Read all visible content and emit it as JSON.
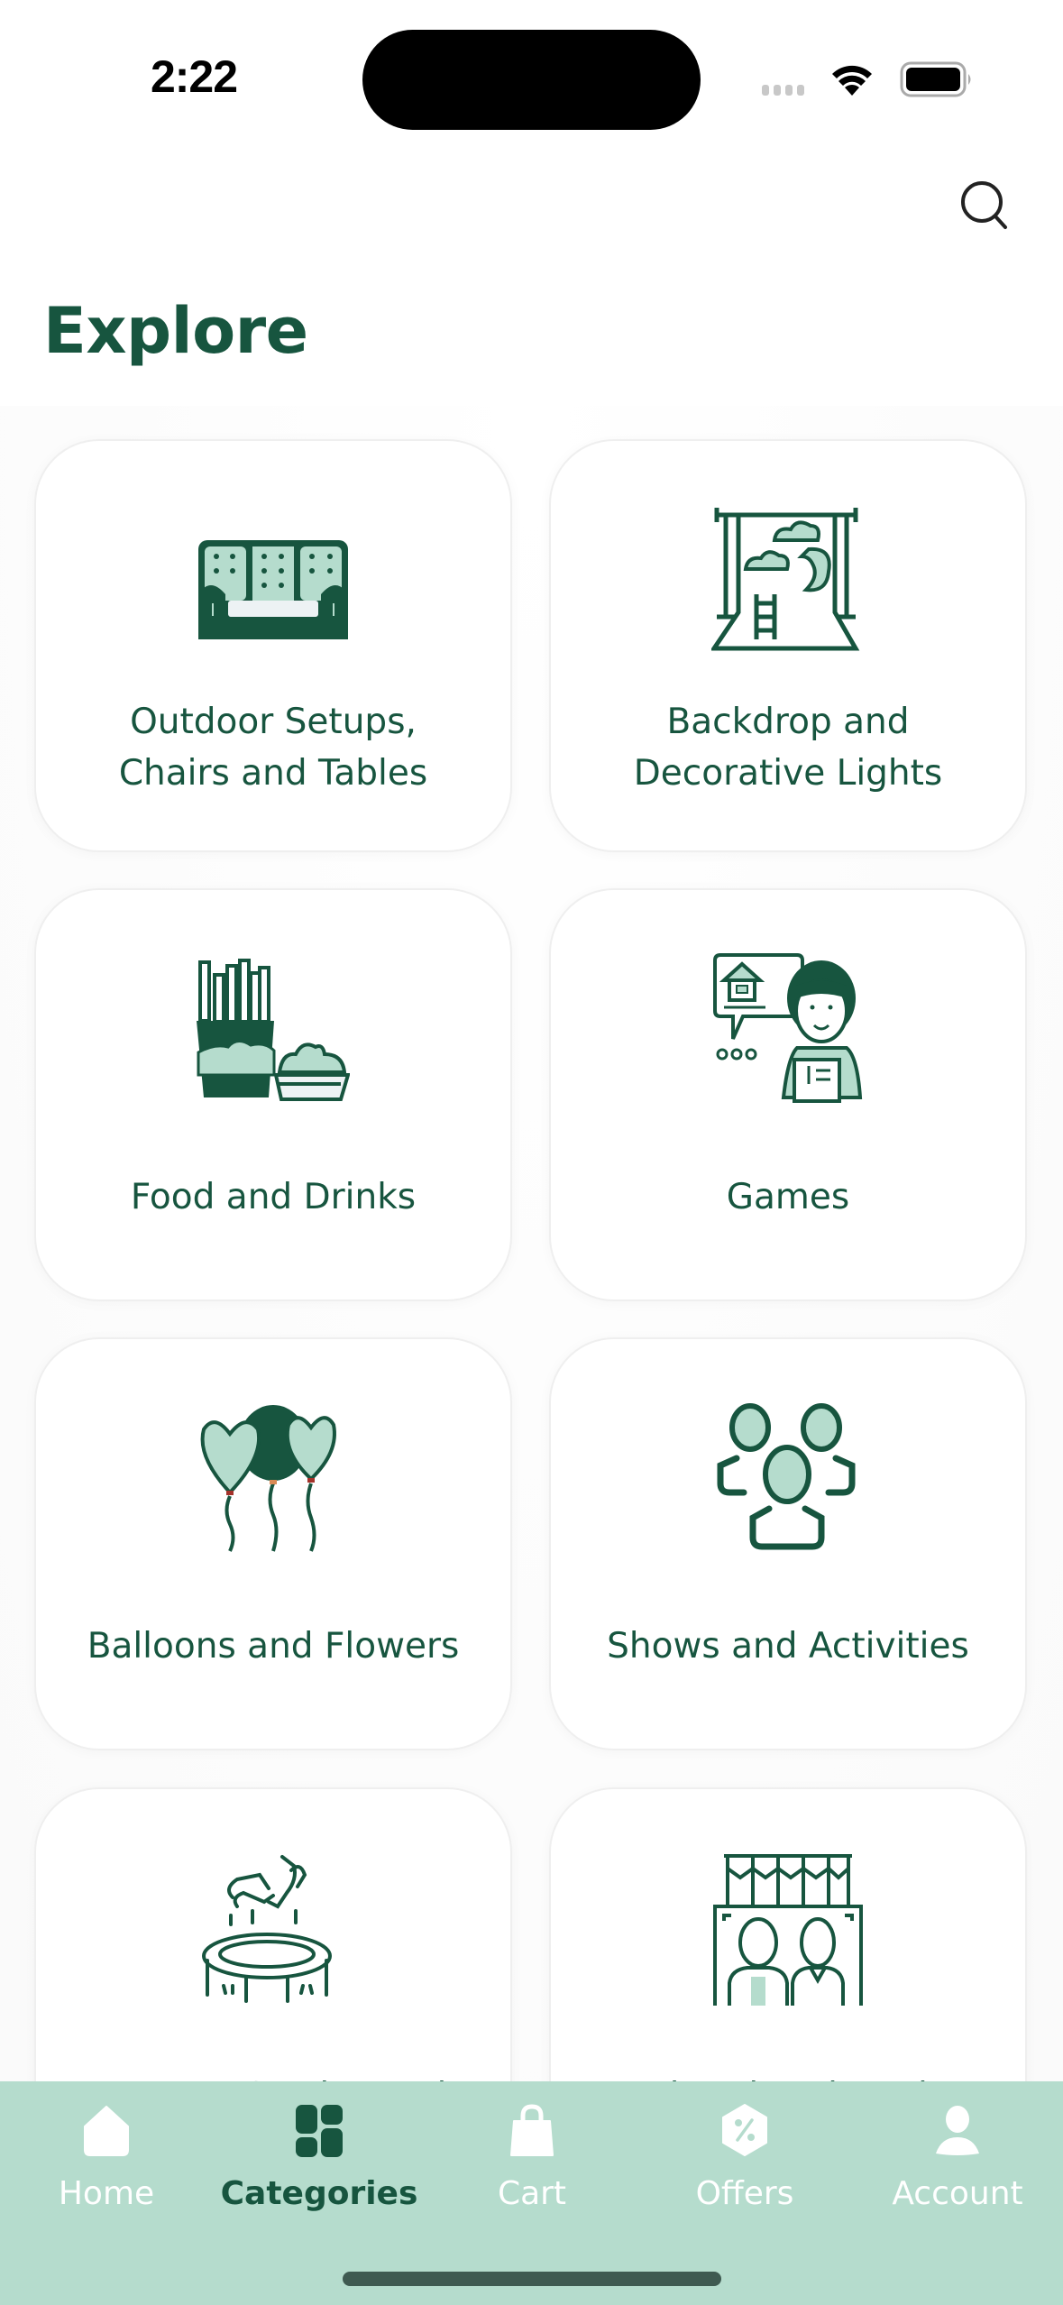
{
  "status_bar": {
    "time": "2:22"
  },
  "header": {
    "search_icon": "search-icon",
    "title": "Explore"
  },
  "colors": {
    "primary": "#17553F",
    "accent_light": "#B5DCCD",
    "tab_bar_bg": "#B5DCCD",
    "card_bg": "#FFFFFF"
  },
  "categories": [
    {
      "label": "Outdoor Setups, Chairs and Tables",
      "line1": "Outdoor Setups,",
      "line2": "Chairs and Tables",
      "icon": "sofa-icon"
    },
    {
      "label": "Backdrop and Decorative Lights",
      "line1": "Backdrop and",
      "line2": "Decorative Lights",
      "icon": "backdrop-icon"
    },
    {
      "label": "Food and Drinks",
      "line1": "Food and Drinks",
      "line2": "",
      "icon": "fries-food-icon"
    },
    {
      "label": "Games",
      "line1": "Games",
      "line2": "",
      "icon": "game-host-icon"
    },
    {
      "label": "Balloons and Flowers",
      "line1": "Balloons and Flowers",
      "line2": "",
      "icon": "balloons-icon"
    },
    {
      "label": "Shows and Activities",
      "line1": "Shows and Activities",
      "line2": "",
      "icon": "group-people-icon"
    },
    {
      "label": "Bouncy Castles and",
      "line1": "Bouncy Castles and",
      "line2": "",
      "icon": "trampoline-icon"
    },
    {
      "label": "Photobooth and",
      "line1": "Photobooth and",
      "line2": "",
      "icon": "photobooth-icon"
    }
  ],
  "tab_bar": {
    "active": "Categories",
    "tabs": [
      {
        "label": "Home",
        "icon": "home-icon"
      },
      {
        "label": "Categories",
        "icon": "categories-grid-icon"
      },
      {
        "label": "Cart",
        "icon": "shopping-bag-icon"
      },
      {
        "label": "Offers",
        "icon": "discount-tag-icon"
      },
      {
        "label": "Account",
        "icon": "user-icon"
      }
    ]
  }
}
